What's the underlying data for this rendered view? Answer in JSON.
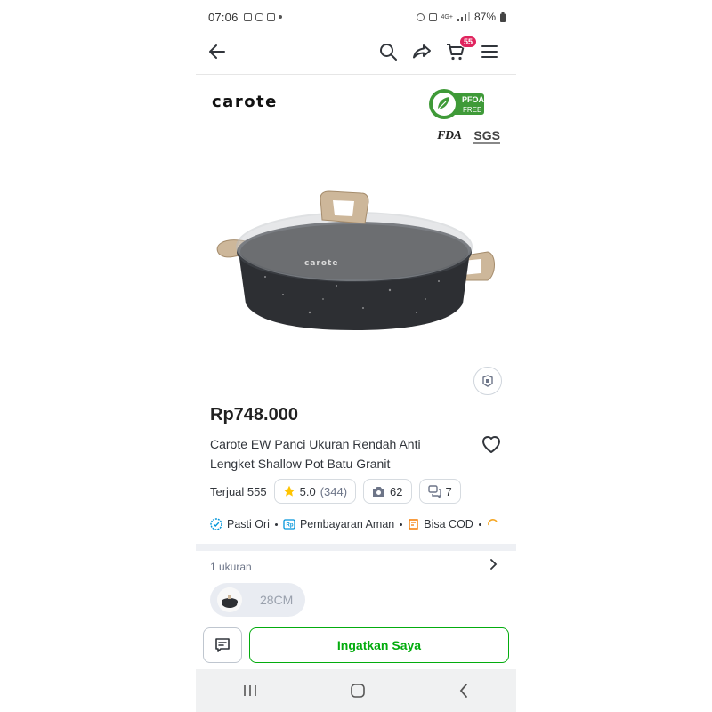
{
  "status_bar": {
    "time": "07:06",
    "battery": "87%",
    "network": "4G+"
  },
  "nav": {
    "cart_count": "55",
    "icons": [
      "back-arrow-icon",
      "search-icon",
      "share-icon",
      "cart-icon",
      "menu-icon"
    ]
  },
  "hero": {
    "brand": "carote",
    "badge_pfoa": "PFOA",
    "badge_free": "FREE",
    "cert_fda": "FDA",
    "cert_sgs": "SGS",
    "pot_brand": "carote"
  },
  "product": {
    "price": "Rp748.000",
    "title": "Carote EW Panci Ukuran Rendah Anti Lengket Shallow Pot Batu Granit",
    "sold": "Terjual 555",
    "rating": "5.0",
    "rating_count": "(344)",
    "photos": "62",
    "discussions": "7"
  },
  "features": [
    {
      "label": "Pasti Ori"
    },
    {
      "label": "Pembayaran Aman"
    },
    {
      "label": "Bisa COD"
    }
  ],
  "variants": {
    "heading": "1 ukuran",
    "selected": "28CM"
  },
  "actions": {
    "remind": "Ingatkan Saya"
  },
  "colors": {
    "primary_green": "#03ac0e",
    "badge_red": "#e0245e",
    "star": "#ffc400"
  }
}
